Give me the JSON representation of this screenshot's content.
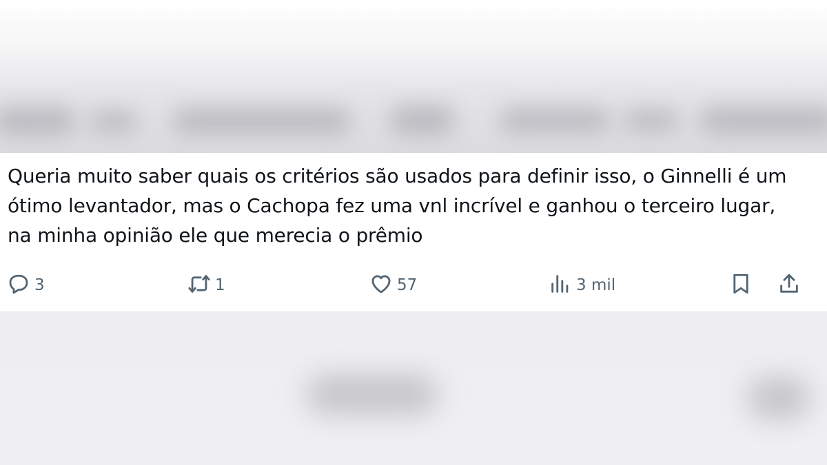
{
  "tweet": {
    "text": "Queria muito saber quais os critérios são usados para definir isso, o Ginnelli é um ótimo levantador, mas o Cachopa fez uma vnl incrível e ganhou o terceiro lugar, na minha opinião ele que merecia o prêmio"
  },
  "actions": {
    "reply": {
      "icon": "reply-icon",
      "count": "3"
    },
    "retweet": {
      "icon": "retweet-icon",
      "count": "1"
    },
    "like": {
      "icon": "heart-icon",
      "count": "57"
    },
    "views": {
      "icon": "views-icon",
      "count": "3 mil"
    },
    "bookmark": {
      "icon": "bookmark-icon"
    },
    "share": {
      "icon": "share-icon"
    }
  },
  "colors": {
    "text": "#0f1419",
    "secondary": "#536471",
    "card": "#ffffff"
  }
}
